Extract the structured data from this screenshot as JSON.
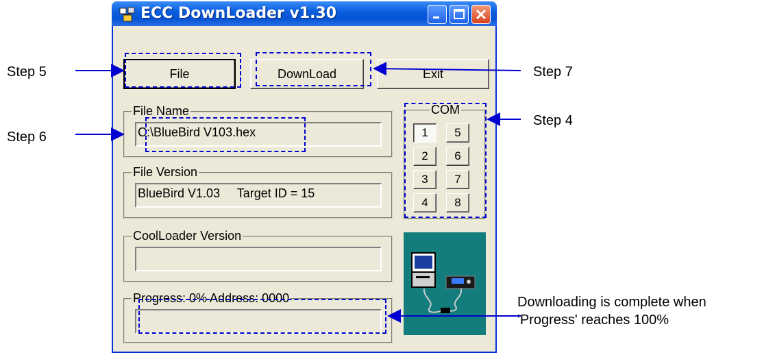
{
  "window": {
    "title": "ECC DownLoader v1.30",
    "controls": {
      "minimize": "minimize-icon",
      "maximize": "maximize-icon",
      "close": "close-icon"
    }
  },
  "toolbar": {
    "file_label": "File",
    "download_label": "DownLoad",
    "exit_label": "Exit"
  },
  "file_name": {
    "label": "File Name",
    "value": "C:\\BlueBird V103.hex"
  },
  "file_version": {
    "label": "File Version",
    "value": "BlueBird V1.03     Target ID = 15"
  },
  "coolloader_version": {
    "label": "CoolLoader Version",
    "value": ""
  },
  "progress": {
    "label": "Progress:      0%  Address: 0000",
    "percent": 0
  },
  "com": {
    "label": "COM",
    "ports": [
      "1",
      "5",
      "2",
      "6",
      "3",
      "7",
      "4",
      "8"
    ],
    "selected": "1"
  },
  "callouts": {
    "step5": "Step 5",
    "step6": "Step 6",
    "step7": "Step 7",
    "step4": "Step 4",
    "progress_note_line1": "Downloading is complete when",
    "progress_note_line2": "'Progress' reaches 100%"
  },
  "colors": {
    "annotation": "#0000d0",
    "titlebar": "#0a5fe0",
    "illustration_bg": "#137d7d"
  }
}
